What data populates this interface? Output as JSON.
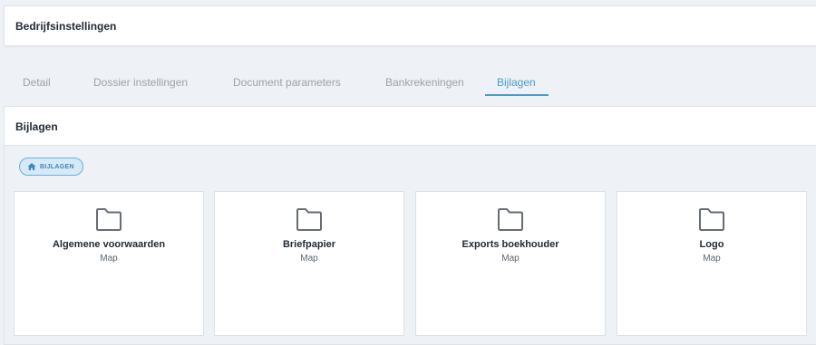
{
  "header": {
    "title": "Bedrijfsinstellingen"
  },
  "tabs": [
    {
      "label": "Detail",
      "active": false
    },
    {
      "label": "Dossier instellingen",
      "active": false
    },
    {
      "label": "Document parameters",
      "active": false
    },
    {
      "label": "Bankrekeningen",
      "active": false
    },
    {
      "label": "Bijlagen",
      "active": true
    }
  ],
  "section": {
    "title": "Bijlagen",
    "breadcrumb": {
      "label": "BIJLAGEN",
      "icon": "home-icon"
    },
    "folders": [
      {
        "name": "Algemene voorwaarden",
        "type": "Map",
        "icon": "folder-icon"
      },
      {
        "name": "Briefpapier",
        "type": "Map",
        "icon": "folder-icon"
      },
      {
        "name": "Exports boekhouder",
        "type": "Map",
        "icon": "folder-icon"
      },
      {
        "name": "Logo",
        "type": "Map",
        "icon": "folder-icon"
      }
    ]
  },
  "colors": {
    "accent": "#4a9ac9",
    "inactive_tab": "#9aa3ad",
    "background": "#eef1f5"
  }
}
